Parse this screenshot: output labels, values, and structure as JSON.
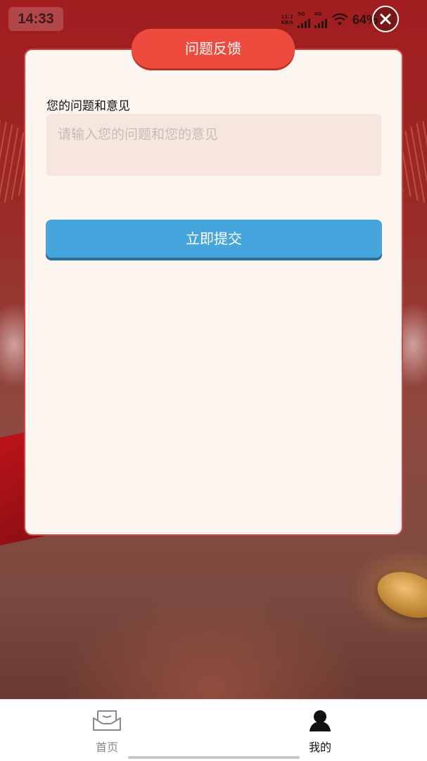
{
  "status_bar": {
    "time": "14:33",
    "net_speed_value": "11.1",
    "net_speed_unit": "KB/s",
    "sim1_label": "5G",
    "sim2_label": "4G",
    "battery": "64%"
  },
  "dialog": {
    "title": "问题反馈",
    "field_label": "您的问题和意见",
    "input_placeholder": "请输入您的问题和您的意见",
    "input_value": "",
    "submit_label": "立即提交"
  },
  "bottom_nav": {
    "items": [
      {
        "label": "首页",
        "icon": "inbox-icon",
        "active": false
      },
      {
        "label": "我的",
        "icon": "user-icon",
        "active": true
      }
    ]
  },
  "colors": {
    "title_pill": "#ec4b3e",
    "submit_button": "#47a5dd",
    "card_background": "#fdf5f0",
    "card_border": "#d04444",
    "input_background": "#f7e6de"
  }
}
